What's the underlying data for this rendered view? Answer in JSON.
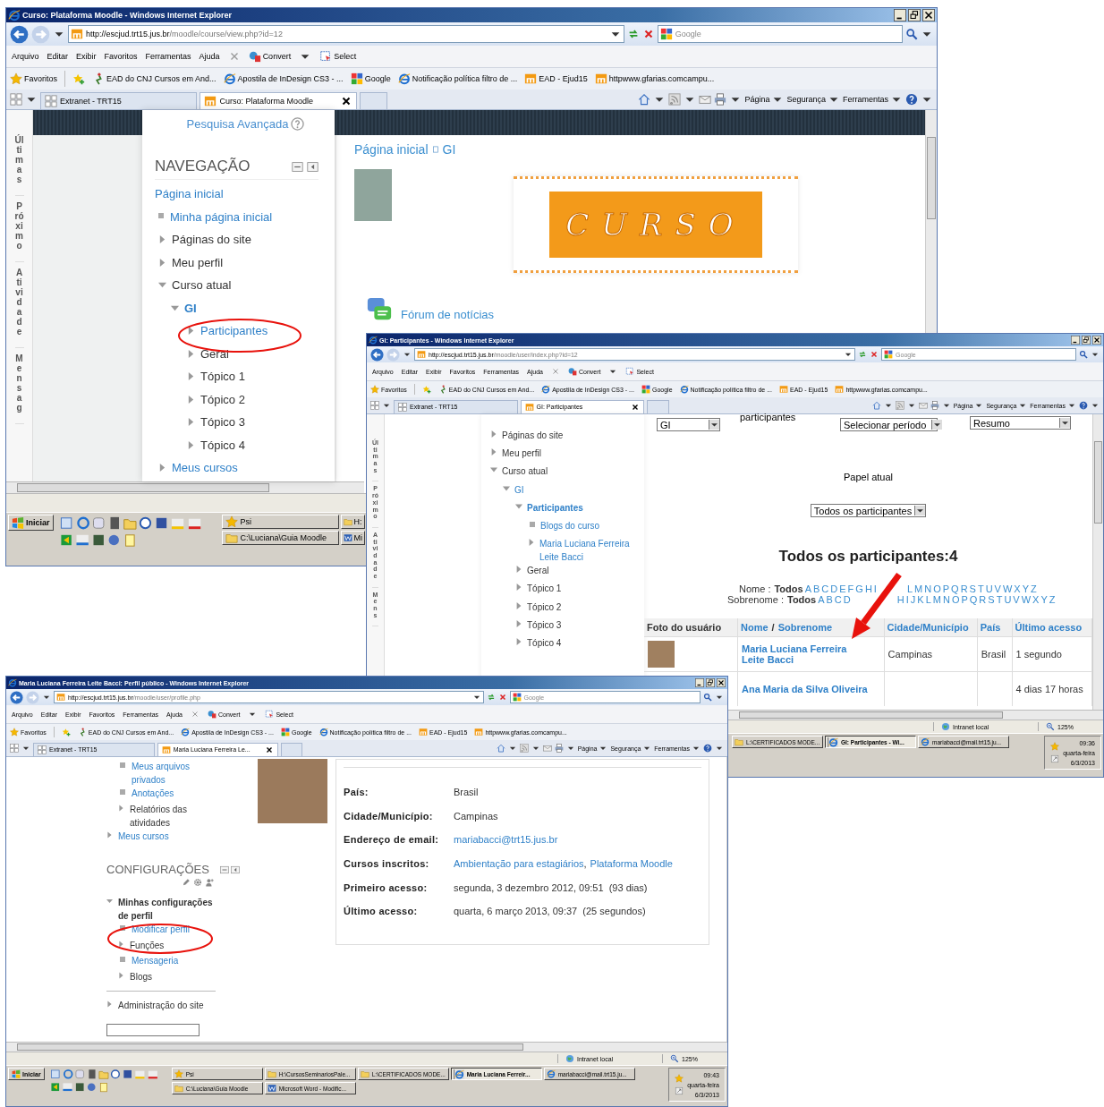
{
  "windows": [
    {
      "kind": "course",
      "title": "Curso: Plataforma Moodle - Windows Internet Explorer",
      "url_host": "http://escjud.trt15.jus.br",
      "url_path": "/moodle/course/view.php?id=12",
      "search_placeholder": "Google",
      "menu": [
        "Arquivo",
        "Editar",
        "Exibir",
        "Favoritos",
        "Ferramentas",
        "Ajuda"
      ],
      "tools": [
        "Convert",
        "Select"
      ],
      "favorites_label": "Favoritos",
      "favorites": [
        {
          "label": "EAD do CNJ Cursos em And...",
          "kind": "cnj"
        },
        {
          "label": "Apostila de InDesign CS3 - ...",
          "kind": "ie"
        },
        {
          "label": "Google",
          "kind": "google"
        },
        {
          "label": "Notificação política filtro de ...",
          "kind": "ie"
        },
        {
          "label": "EAD - Ejud15",
          "kind": "moodle"
        },
        {
          "label": "httpwww.gfarias.comcampu...",
          "kind": "moodle"
        }
      ],
      "tabs": [
        {
          "label": "Extranet - TRT15",
          "selected": false
        },
        {
          "label": "Curso: Plataforma Moodle",
          "selected": true
        }
      ],
      "commands": [
        "Página",
        "Segurança",
        "Ferramentas"
      ],
      "side_tabs": [
        "Últimas",
        "Próximo",
        "Atividade",
        "Mensag"
      ],
      "advanced_search": "Pesquisa Avançada",
      "nav_title": "NAVEGAÇÃO",
      "nav": [
        {
          "label": "Página inicial",
          "kind": "root",
          "link": true
        },
        {
          "label": "Minha página inicial",
          "kind": "leaf",
          "link": true
        },
        {
          "label": "Páginas do site",
          "kind": "branch",
          "expanded": false,
          "link": false
        },
        {
          "label": "Meu perfil",
          "kind": "branch",
          "expanded": false,
          "link": false
        },
        {
          "label": "Curso atual",
          "kind": "branch",
          "expanded": true,
          "link": false,
          "children": [
            {
              "label": "GI",
              "kind": "branch",
              "expanded": true,
              "link": true,
              "current": true,
              "children": [
                {
                  "label": "Participantes",
                  "kind": "branch",
                  "expanded": false,
                  "link": true
                },
                {
                  "label": "Geral",
                  "kind": "branch",
                  "expanded": false,
                  "link": false
                },
                {
                  "label": "Tópico 1",
                  "kind": "branch",
                  "expanded": false,
                  "link": false
                },
                {
                  "label": "Tópico 2",
                  "kind": "branch",
                  "expanded": false,
                  "link": false
                },
                {
                  "label": "Tópico 3",
                  "kind": "branch",
                  "expanded": false,
                  "link": false
                },
                {
                  "label": "Tópico 4",
                  "kind": "branch",
                  "expanded": false,
                  "link": false
                }
              ]
            }
          ]
        },
        {
          "label": "Meus cursos",
          "kind": "branch",
          "expanded": false,
          "link": true
        }
      ],
      "breadcrumb": [
        "Página inicial",
        "GI"
      ],
      "banner_text": "CURSO",
      "forum": "Fórum de notícias",
      "taskbar": {
        "start": "Iniciar",
        "rows": [
          [
            {
              "label": "Psi",
              "kind": "star",
              "selected": false
            },
            {
              "label": "H:",
              "kind": "folder",
              "selected": false
            }
          ],
          [
            {
              "label": "C:\\Luciana\\Guia Moodle",
              "kind": "folder",
              "selected": false
            },
            {
              "label": "Mi",
              "kind": "word",
              "selected": false
            }
          ]
        ]
      }
    },
    {
      "kind": "participants",
      "title": "GI: Participantes - Windows Internet Explorer",
      "url_host": "http://escjud.trt15.jus.br",
      "url_path": "/moodle/user/index.php?id=12",
      "search_placeholder": "Google",
      "menu": [
        "Arquivo",
        "Editar",
        "Exibir",
        "Favoritos",
        "Ferramentas",
        "Ajuda"
      ],
      "tools": [
        "Convert",
        "Select"
      ],
      "favorites_label": "Favoritos",
      "favorites": [
        {
          "label": "EAD do CNJ Cursos em And...",
          "kind": "cnj"
        },
        {
          "label": "Apostila de InDesign CS3 - ...",
          "kind": "ie"
        },
        {
          "label": "Google",
          "kind": "google"
        },
        {
          "label": "Notificação política filtro de ...",
          "kind": "ie"
        },
        {
          "label": "EAD - Ejud15",
          "kind": "moodle"
        },
        {
          "label": "httpwww.gfarias.comcampu...",
          "kind": "moodle"
        }
      ],
      "tabs": [
        {
          "label": "Extranet - TRT15",
          "selected": false
        },
        {
          "label": "GI: Participantes",
          "selected": true
        }
      ],
      "commands": [
        "Página",
        "Segurança",
        "Ferramentas"
      ],
      "side_tabs": [
        "Últimas",
        "Próximo",
        "Atividade",
        "Mens"
      ],
      "nav": [
        {
          "label": "Páginas do site",
          "kind": "branch",
          "expanded": false,
          "link": false
        },
        {
          "label": "Meu perfil",
          "kind": "branch",
          "expanded": false,
          "link": false
        },
        {
          "label": "Curso atual",
          "kind": "branch",
          "expanded": true,
          "link": false,
          "children": [
            {
              "label": "GI",
              "kind": "branch",
              "expanded": true,
              "link": true,
              "children": [
                {
                  "label": "Participantes",
                  "kind": "branch",
                  "expanded": true,
                  "link": true,
                  "current": true,
                  "children": [
                    {
                      "label": "Blogs do curso",
                      "kind": "leaf",
                      "link": true
                    },
                    {
                      "label": "Maria Luciana Ferreira Leite Bacci",
                      "kind": "branch",
                      "expanded": false,
                      "link": true
                    }
                  ]
                },
                {
                  "label": "Geral",
                  "kind": "branch",
                  "expanded": false,
                  "link": false
                },
                {
                  "label": "Tópico 1",
                  "kind": "branch",
                  "expanded": false,
                  "link": false
                },
                {
                  "label": "Tópico 2",
                  "kind": "branch",
                  "expanded": false,
                  "link": false
                },
                {
                  "label": "Tópico 3",
                  "kind": "branch",
                  "expanded": false,
                  "link": false
                },
                {
                  "label": "Tópico 4",
                  "kind": "branch",
                  "expanded": false,
                  "link": false
                }
              ]
            }
          ]
        }
      ],
      "filters": {
        "course": "GI",
        "participants_label": "participantes",
        "period": "Selecionar período",
        "view": "Resumo"
      },
      "role_label": "Papel atual",
      "role": "Todos os participantes",
      "heading": "Todos os participantes:4",
      "name_filters": [
        {
          "label": "Nome :",
          "all": "Todos",
          "groups": [
            [
              "A",
              "B",
              "C",
              "D",
              "E",
              "F",
              "G",
              "H",
              "I"
            ],
            [
              "L",
              "M",
              "N",
              "O",
              "P",
              "Q",
              "R",
              "S",
              "T",
              "U",
              "V",
              "W",
              "X",
              "Y",
              "Z"
            ]
          ]
        },
        {
          "label": "Sobrenome :",
          "all": "Todos",
          "groups": [
            [
              "A",
              "B",
              "C",
              "D"
            ],
            [
              "H",
              "I",
              "J",
              "K",
              "L",
              "M",
              "N",
              "O",
              "P",
              "Q",
              "R",
              "S",
              "T",
              "U",
              "V",
              "W",
              "X",
              "Y",
              "Z"
            ]
          ]
        }
      ],
      "table": {
        "columns": [
          {
            "labels": [
              "Foto do usuário"
            ],
            "link": false
          },
          {
            "labels": [
              "Nome",
              "Sobrenome"
            ],
            "separator": "/",
            "link": true
          },
          {
            "labels": [
              "Cidade/Município"
            ],
            "link": true
          },
          {
            "labels": [
              "País"
            ],
            "link": true
          },
          {
            "labels": [
              "Último acesso"
            ],
            "link": true
          }
        ],
        "rows": [
          {
            "photo": true,
            "name": "Maria Luciana Ferreira Leite Bacci",
            "city": "Campinas",
            "country": "Brasil",
            "last_access": "1 segundo"
          },
          {
            "name": "Ana Maria da Silva Oliveira",
            "last_access": "4 dias 17 horas"
          }
        ]
      },
      "status": {
        "zone": "Intranet local",
        "zoom": "125%"
      },
      "taskbar": {
        "rows": [
          [
            {
              "label": "L:\\CERTIFICADOS MODE...",
              "kind": "folder",
              "selected": false
            },
            {
              "label": "GI: Participantes - Wi...",
              "kind": "ie",
              "selected": true
            },
            {
              "label": "mariabacci@mail.trt15.ju...",
              "kind": "ie",
              "selected": false
            }
          ]
        ]
      },
      "clock": {
        "time": "09:36",
        "day": "quarta-feira",
        "date": "6/3/2013"
      }
    },
    {
      "kind": "profile",
      "title": "Maria Luciana Ferreira Leite Bacci: Perfil público - Windows Internet Explorer",
      "url_host": "http://escjud.trt15.jus.br",
      "url_path": "/moodle/user/profile.php",
      "search_placeholder": "Google",
      "menu": [
        "Arquivo",
        "Editar",
        "Exibir",
        "Favoritos",
        "Ferramentas",
        "Ajuda"
      ],
      "tools": [
        "Convert",
        "Select"
      ],
      "favorites_label": "Favoritos",
      "favorites": [
        {
          "label": "EAD do CNJ Cursos em And...",
          "kind": "cnj"
        },
        {
          "label": "Apostila de InDesign CS3 - ...",
          "kind": "ie"
        },
        {
          "label": "Google",
          "kind": "google"
        },
        {
          "label": "Notificação política filtro de ...",
          "kind": "ie"
        },
        {
          "label": "EAD - Ejud15",
          "kind": "moodle"
        },
        {
          "label": "httpwww.gfarias.comcampu...",
          "kind": "moodle"
        }
      ],
      "tabs": [
        {
          "label": "Extranet - TRT15",
          "selected": false
        },
        {
          "label": "Maria Luciana Ferreira Le...",
          "selected": true
        }
      ],
      "commands": [
        "Página",
        "Segurança",
        "Ferramentas"
      ],
      "nav_upper": [
        {
          "label": "Meus arquivos privados",
          "kind": "leaf",
          "link": true
        },
        {
          "label": "Anotações",
          "kind": "leaf",
          "link": true
        },
        {
          "label": "Relatórios das atividades",
          "kind": "branch",
          "expanded": false,
          "link": false
        }
      ],
      "nav": [
        {
          "label": "Meus cursos",
          "kind": "branch",
          "expanded": false,
          "link": true
        }
      ],
      "settings_title": "CONFIGURAÇÕES",
      "settings": [
        {
          "label": "Minhas configurações de perfil",
          "kind": "branch",
          "expanded": true,
          "link": false,
          "current": true,
          "children": [
            {
              "label": "Modificar perfil",
              "kind": "leaf",
              "link": true
            },
            {
              "label": "Funções",
              "kind": "branch",
              "expanded": false,
              "link": false
            },
            {
              "label": "Mensageria",
              "kind": "leaf",
              "link": true
            },
            {
              "label": "Blogs",
              "kind": "branch",
              "expanded": false,
              "link": false
            }
          ]
        }
      ],
      "admin": [
        {
          "label": "Administração do site",
          "kind": "branch",
          "expanded": false,
          "link": false
        }
      ],
      "fields": [
        {
          "label": "País:",
          "values": [
            "Brasil"
          ],
          "link": false
        },
        {
          "label": "Cidade/Município:",
          "values": [
            "Campinas"
          ],
          "link": false
        },
        {
          "label": "Endereço de email:",
          "values": [
            "mariabacci@trt15.jus.br"
          ],
          "link": true
        },
        {
          "label": "Cursos inscritos:",
          "values": [
            "Ambientação para estagiários",
            "Plataforma Moodle"
          ],
          "separator": ",",
          "link": true
        },
        {
          "label": "Primeiro acesso:",
          "values": [
            "segunda, 3 dezembro 2012, 09:51  (93 dias)"
          ],
          "link": false
        },
        {
          "label": "Último acesso:",
          "values": [
            "quarta, 6 março 2013, 09:37  (25 segundos)"
          ],
          "link": false
        }
      ],
      "status": {
        "zone": "Intranet local",
        "zoom": "125%"
      },
      "taskbar": {
        "start": "Iniciar",
        "rows": [
          [
            {
              "label": "Psi",
              "kind": "star",
              "selected": false
            },
            {
              "label": "H:\\CursosSeminariosPale...",
              "kind": "folder",
              "selected": false
            },
            {
              "label": "L:\\CERTIFICADOS MODE...",
              "kind": "folder",
              "selected": false
            },
            {
              "label": "Maria Luciana Ferreir...",
              "kind": "ie",
              "selected": true
            },
            {
              "label": "mariabacci@mail.trt15.ju...",
              "kind": "ie",
              "selected": false
            }
          ],
          [
            {
              "label": "C:\\Luciana\\Guia Moodle",
              "kind": "folder",
              "selected": false
            },
            {
              "label": "Microsoft Word - Modific...",
              "kind": "word",
              "selected": false
            }
          ]
        ]
      },
      "clock": {
        "time": "09:43",
        "day": "quarta-feira",
        "date": "6/3/2013"
      }
    }
  ]
}
